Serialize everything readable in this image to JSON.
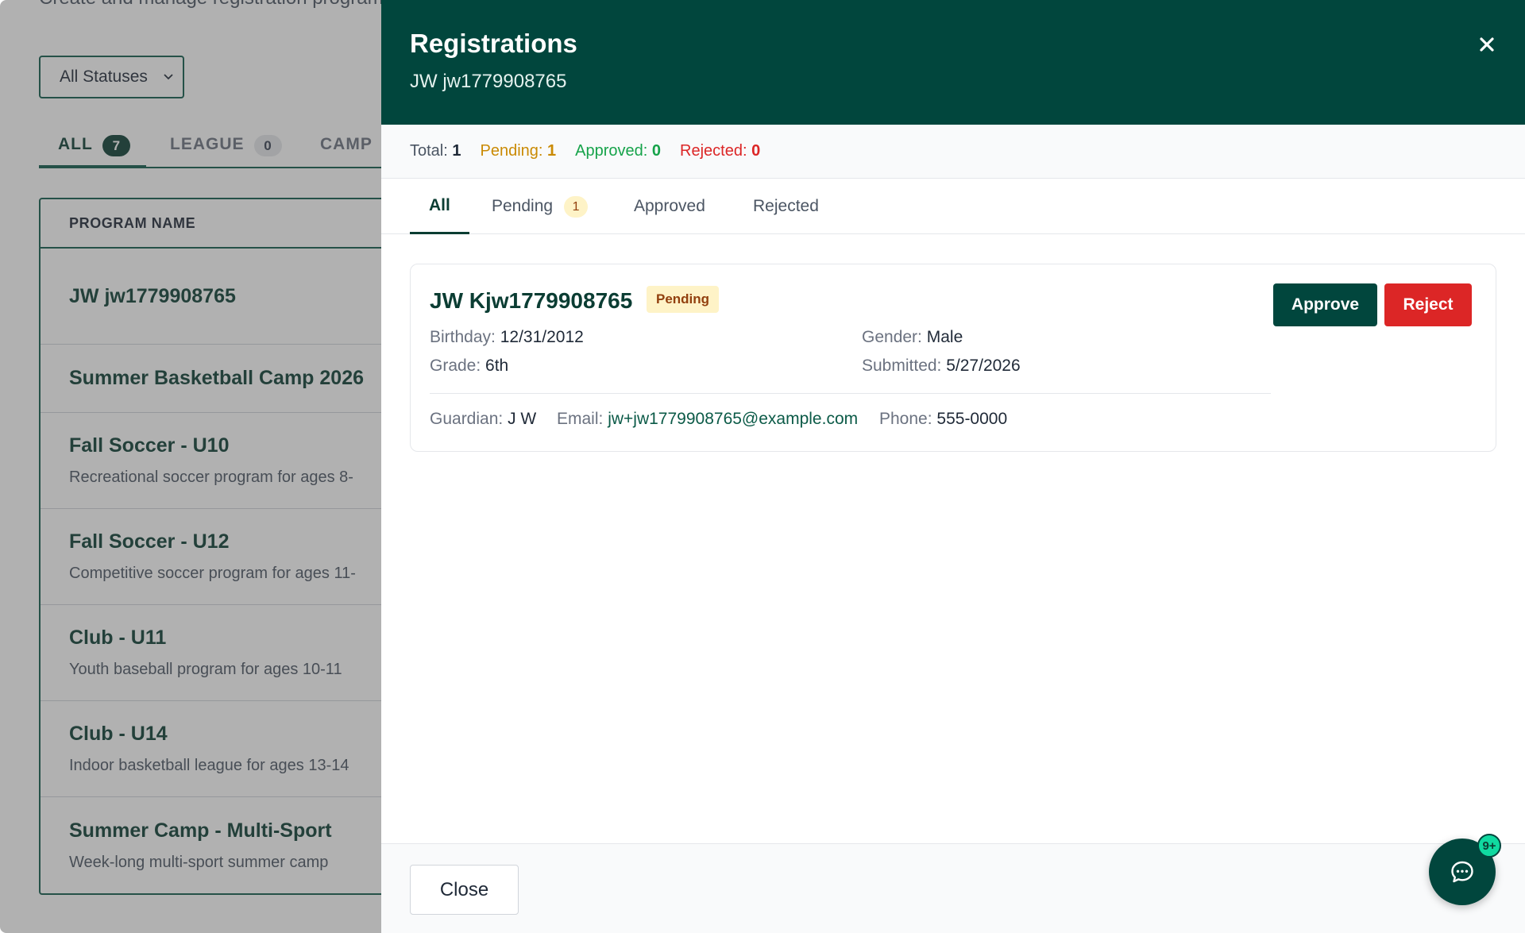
{
  "background": {
    "subtitle": "Create and manage registration programs",
    "status_filter": {
      "selected": "All Statuses"
    },
    "type_tabs": [
      {
        "label": "ALL",
        "count": "7"
      },
      {
        "label": "LEAGUE",
        "count": "0"
      },
      {
        "label": "CAMP"
      }
    ],
    "table": {
      "header": "PROGRAM NAME",
      "rows": [
        {
          "name": "JW jw1779908765",
          "desc": ""
        },
        {
          "name": "Summer Basketball Camp 2026",
          "desc": ""
        },
        {
          "name": "Fall Soccer - U10",
          "desc": "Recreational soccer program for ages 8-"
        },
        {
          "name": "Fall Soccer - U12",
          "desc": "Competitive soccer program for ages 11-"
        },
        {
          "name": "Club - U11",
          "desc": "Youth baseball program for ages 10-11"
        },
        {
          "name": "Club - U14",
          "desc": "Indoor basketball league for ages 13-14"
        },
        {
          "name": "Summer Camp - Multi-Sport",
          "desc": "Week-long multi-sport summer camp"
        }
      ]
    }
  },
  "panel": {
    "title": "Registrations",
    "subtitle": "JW jw1779908765",
    "close_icon": "close-icon",
    "summary": {
      "total_label": "Total:",
      "total": "1",
      "pending_label": "Pending:",
      "pending": "1",
      "approved_label": "Approved:",
      "approved": "0",
      "rejected_label": "Rejected:",
      "rejected": "0"
    },
    "tabs": {
      "all": "All",
      "pending": "Pending",
      "pending_count": "1",
      "approved": "Approved",
      "rejected": "Rejected"
    },
    "registration": {
      "name": "JW Kjw1779908765",
      "status": "Pending",
      "birthday_label": "Birthday:",
      "birthday": "12/31/2012",
      "gender_label": "Gender:",
      "gender": "Male",
      "grade_label": "Grade:",
      "grade": "6th",
      "submitted_label": "Submitted:",
      "submitted": "5/27/2026",
      "guardian_label": "Guardian:",
      "guardian": "J W",
      "email_label": "Email:",
      "email": "jw+jw1779908765@example.com",
      "phone_label": "Phone:",
      "phone": "555-0000",
      "approve_label": "Approve",
      "reject_label": "Reject"
    },
    "footer": {
      "close_label": "Close"
    }
  },
  "chat": {
    "icon": "chat-bubble-icon",
    "badge": "9+"
  },
  "colors": {
    "brand": "#01463d",
    "pending": "#ca8a04",
    "approved": "#16a34a",
    "rejected": "#dc2626"
  }
}
